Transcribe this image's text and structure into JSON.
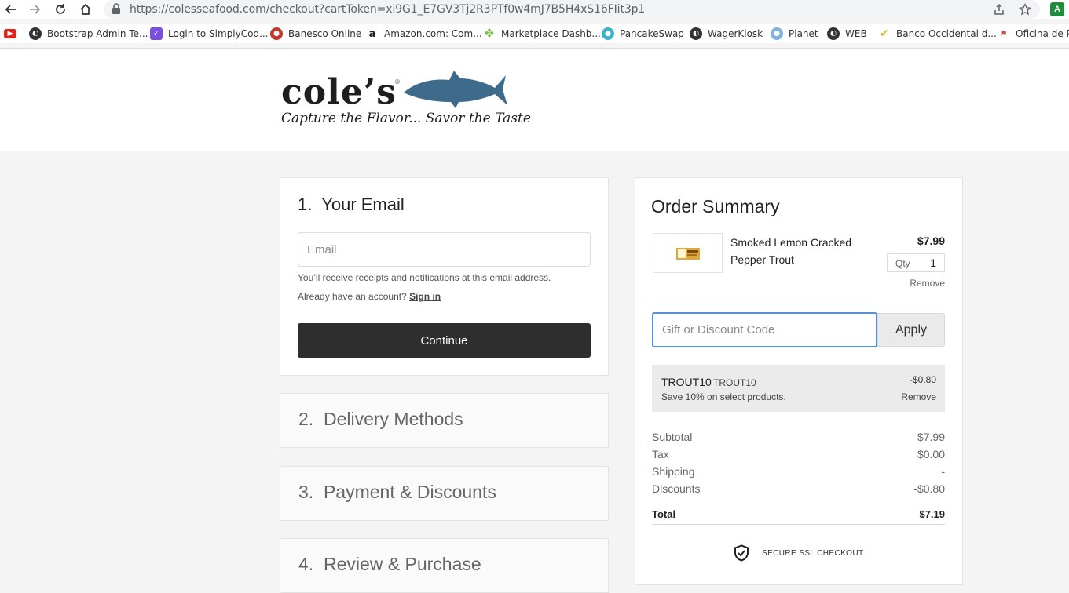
{
  "browser": {
    "url": "https://colesseafood.com/checkout?cartToken=xi9G1_E7GV3Tj2R3PTf0w4mJ7B5H4xS16FIit3p1",
    "bookmarks": [
      {
        "label": "",
        "icon": "youtube-icon",
        "color": "#e62117"
      },
      {
        "label": "Bootstrap Admin Te...",
        "icon": "globe-icon",
        "color": "#333333"
      },
      {
        "label": "Login to SimplyCod...",
        "icon": "simplycode-icon",
        "color": "#7b4fe0"
      },
      {
        "label": "Banesco Online",
        "icon": "banesco-icon",
        "color": "#c0392b"
      },
      {
        "label": "Amazon.com: Com...",
        "icon": "amazon-icon",
        "color": "#222222"
      },
      {
        "label": "Marketplace Dashb...",
        "icon": "clover-icon",
        "color": "#7cc242"
      },
      {
        "label": "PancakeSwap",
        "icon": "pancakeswap-icon",
        "color": "#3ab5c8"
      },
      {
        "label": "WagerKiosk",
        "icon": "globe-icon",
        "color": "#333333"
      },
      {
        "label": "Planet",
        "icon": "planet-icon",
        "color": "#7fb2e0"
      },
      {
        "label": "WEB",
        "icon": "globe-icon",
        "color": "#333333"
      },
      {
        "label": "Banco Occidental d...",
        "icon": "banco-occidental-icon",
        "color": "#c9c22c"
      },
      {
        "label": "Oficina de Pl",
        "icon": "oficina-icon",
        "color": "#d14b4b"
      }
    ]
  },
  "brand": {
    "name": "cole’s",
    "reg": "®",
    "tagline": "Capture the Flavor... Savor the Taste",
    "fish_color": "#3e6a8c"
  },
  "checkout": {
    "step1": {
      "number": "1.",
      "title": "Your Email",
      "email_placeholder": "Email",
      "help_receipts": "You’ll receive receipts and notifications at this email address.",
      "help_account": "Already have an account?",
      "signin_label": "Sign in",
      "continue_label": "Continue"
    },
    "steps": [
      {
        "number": "2.",
        "title": "Delivery Methods"
      },
      {
        "number": "3.",
        "title": "Payment & Discounts"
      },
      {
        "number": "4.",
        "title": "Review & Purchase"
      }
    ]
  },
  "summary": {
    "title": "Order Summary",
    "item": {
      "name": "Smoked Lemon Cracked Pepper Trout",
      "price": "$7.99",
      "qty_label": "Qty",
      "qty": "1",
      "remove_label": "Remove"
    },
    "code_placeholder": "Gift or Discount Code",
    "apply_label": "Apply",
    "discount": {
      "code": "TROUT10",
      "tag": "TROUT10",
      "amount": "-$0.80",
      "description": "Save 10% on select products.",
      "remove_label": "Remove"
    },
    "rows": [
      {
        "label": "Subtotal",
        "value": "$7.99"
      },
      {
        "label": "Tax",
        "value": "$0.00"
      },
      {
        "label": "Shipping",
        "value": "-"
      },
      {
        "label": "Discounts",
        "value": "-$0.80"
      }
    ],
    "total": {
      "label": "Total",
      "value": "$7.19"
    },
    "secure_label": "SECURE SSL CHECKOUT"
  }
}
